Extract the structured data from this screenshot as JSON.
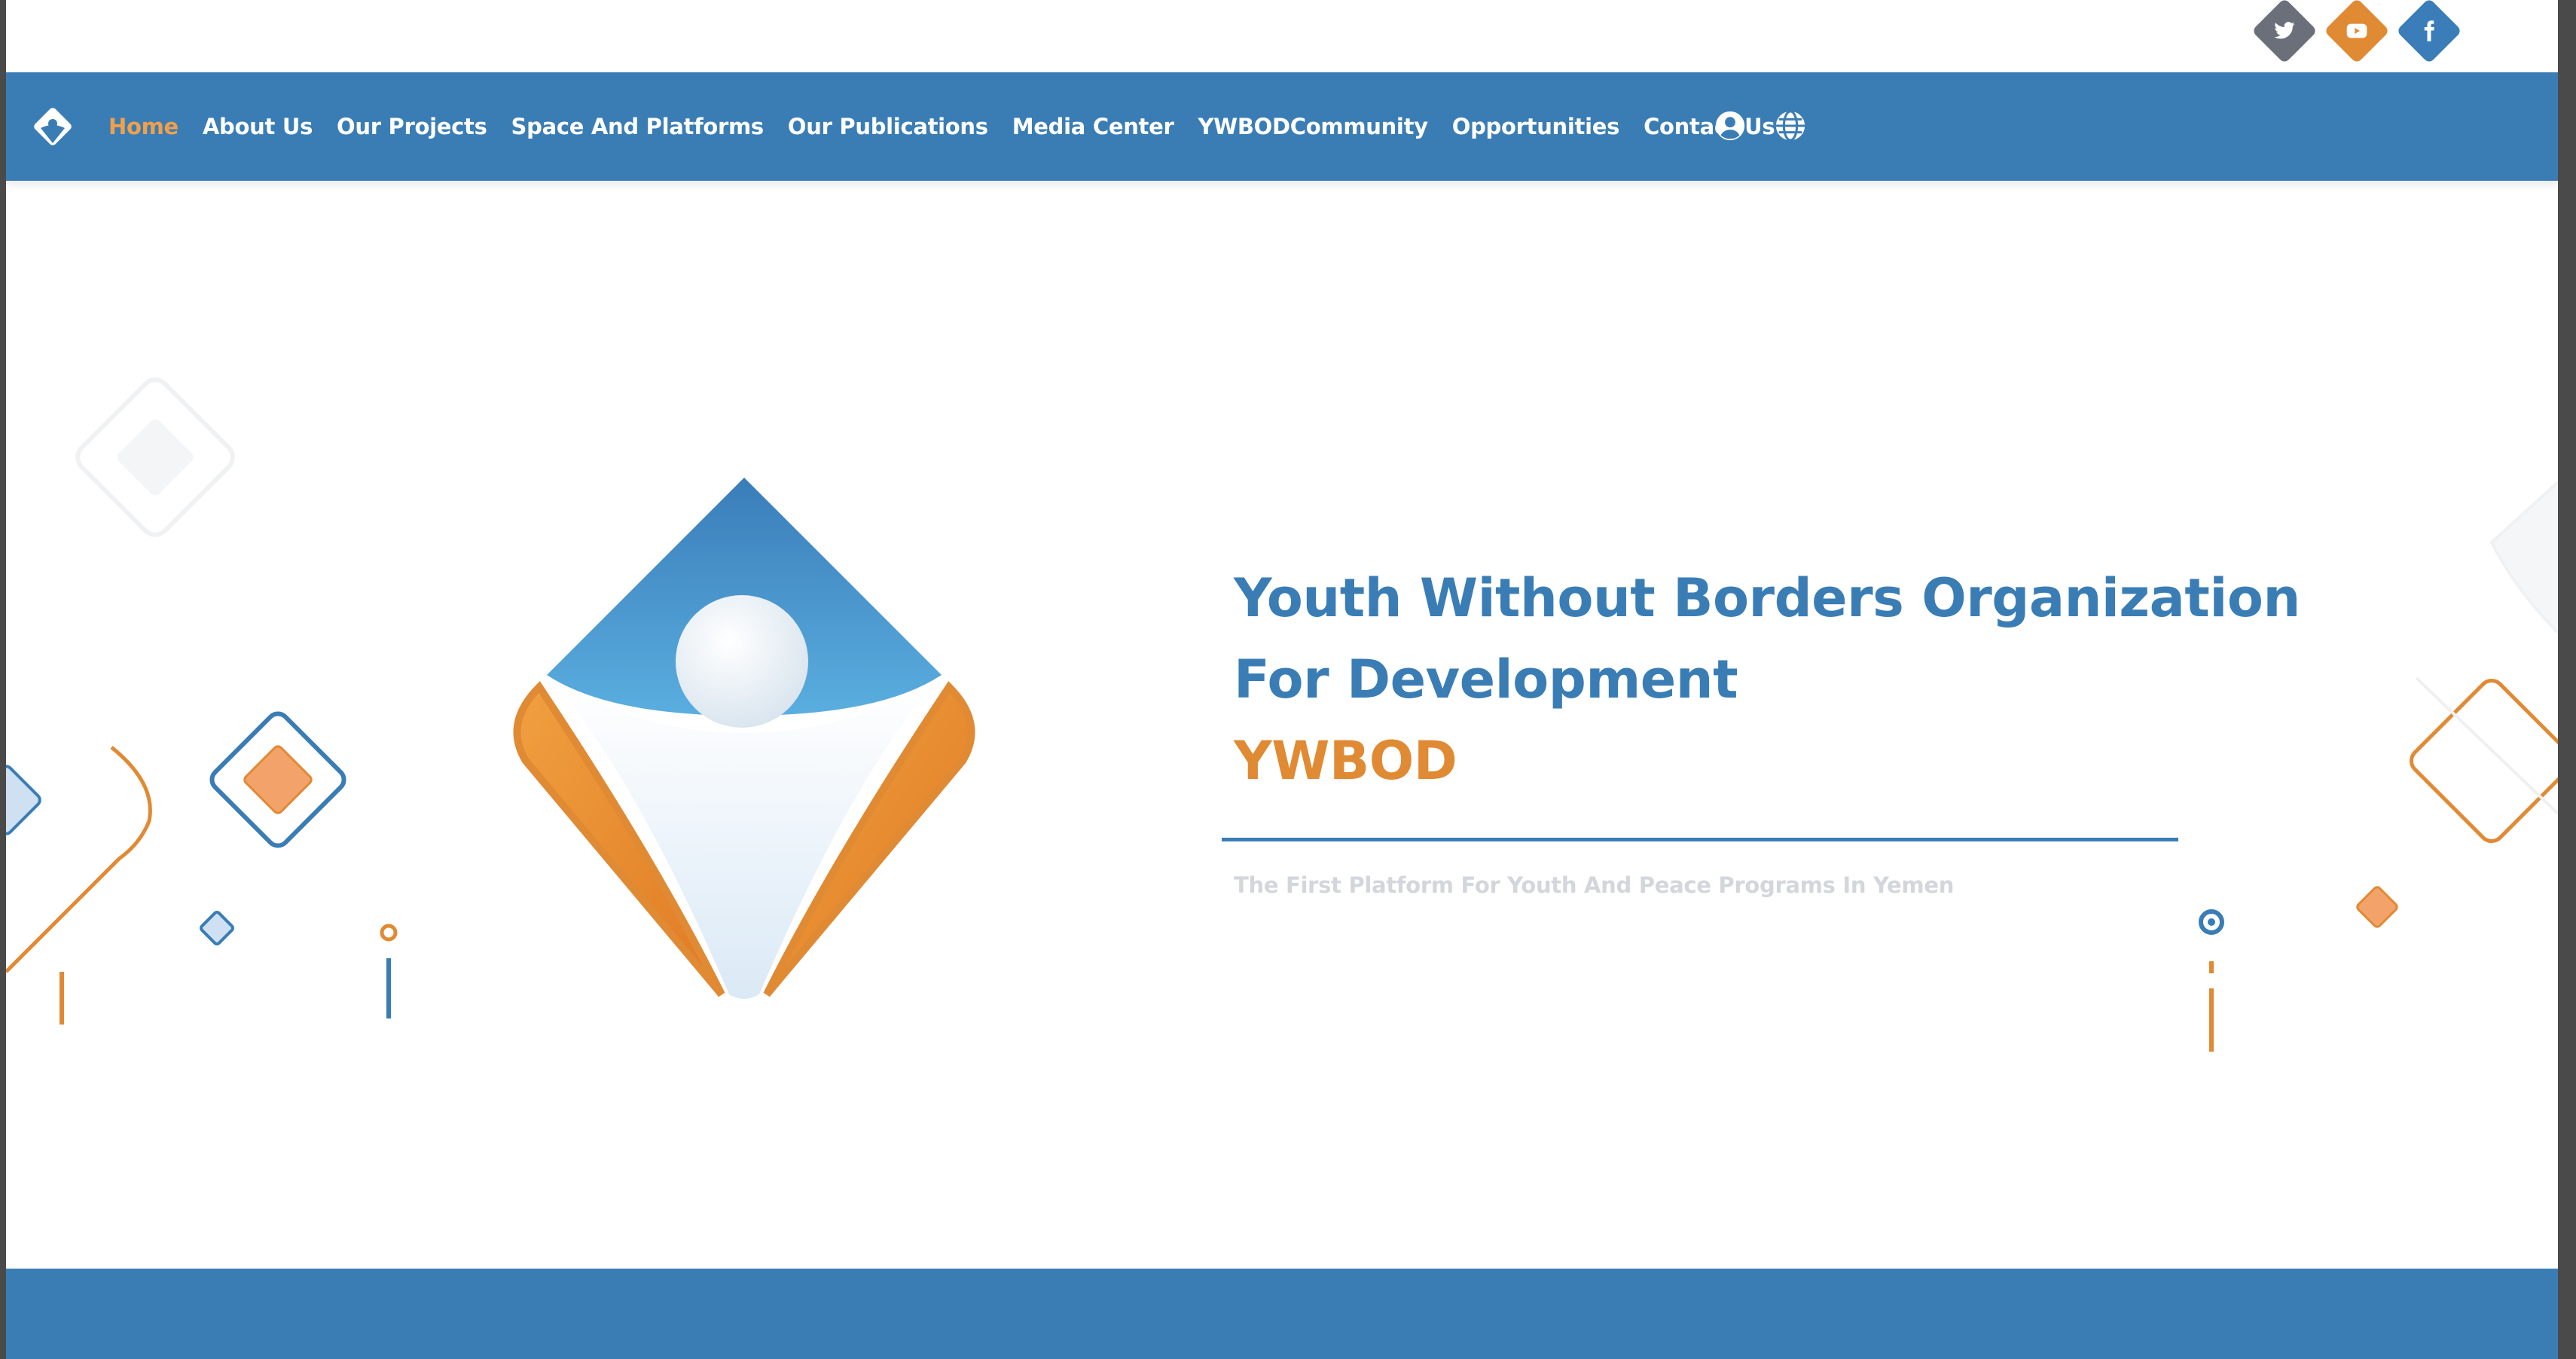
{
  "social": {
    "twitter_icon": "twitter-icon",
    "youtube_icon": "youtube-icon",
    "facebook_icon": "facebook-icon"
  },
  "nav": {
    "items": [
      {
        "label": "Home",
        "active": true
      },
      {
        "label": "About Us"
      },
      {
        "label": "Our Projects"
      },
      {
        "label": "Space And Platforms"
      },
      {
        "label": "Our Publications"
      },
      {
        "label": "Media Center"
      },
      {
        "label": "YWBODCommunity"
      },
      {
        "label": "Opportunities"
      },
      {
        "label": "Contact Us"
      }
    ],
    "user_icon": "user-circle-icon",
    "language_icon": "globe-icon"
  },
  "hero": {
    "title_line1": "Youth Without Borders Organization",
    "title_line2": "For Development",
    "title_line3": "YWBOD",
    "subtitle": "The First Platform For Youth And Peace Programs In Yemen"
  },
  "colors": {
    "primary_blue": "#3a7db5",
    "accent_orange": "#e08a34",
    "active_nav": "#f0a04b",
    "muted_text": "#d3d6db"
  }
}
